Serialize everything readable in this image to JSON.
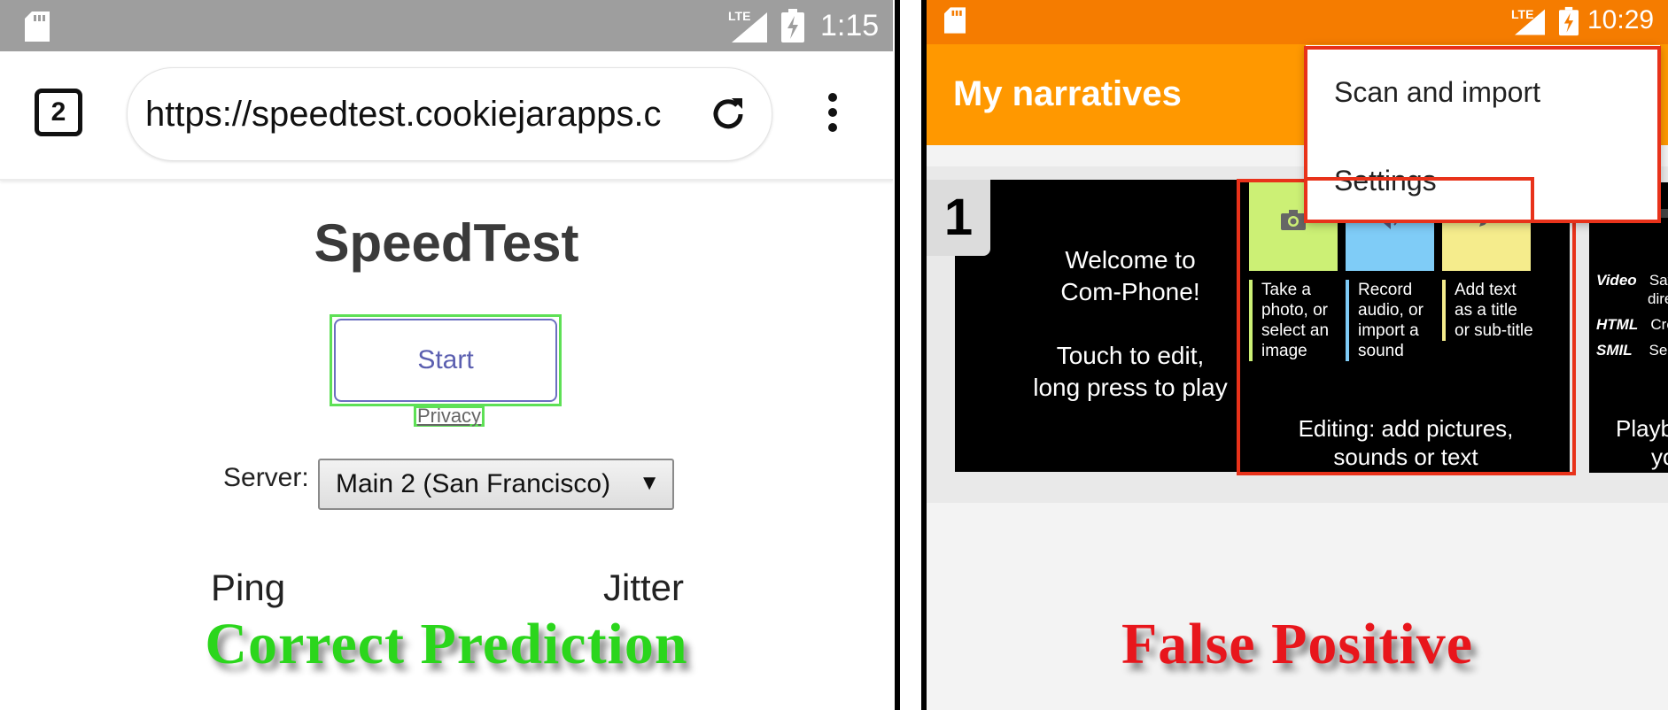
{
  "left_panel": {
    "status_bar": {
      "time": "1:15",
      "network": "LTE",
      "icons": [
        "sd-card-icon",
        "signal-icon",
        "battery-charging-icon"
      ]
    },
    "browser": {
      "tab_count": "2",
      "url": "https://speedtest.cookiejarapps.c",
      "icons": [
        "refresh-icon",
        "more-vert-icon"
      ]
    },
    "page": {
      "title": "SpeedTest",
      "start_button": "Start",
      "privacy_link": "Privacy",
      "server_label": "Server:",
      "server_value": "Main 2 (San Francisco)",
      "server_arrow": "▼",
      "ping_label": "Ping",
      "jitter_label": "Jitter"
    },
    "verdict": "Correct Prediction",
    "highlight_color": "#5ee056"
  },
  "right_panel": {
    "status_bar": {
      "time": "10:29",
      "network": "LTE",
      "icons": [
        "sd-card-icon",
        "signal-icon",
        "battery-charging-icon"
      ]
    },
    "app_bar": {
      "title": "My narratives",
      "color": "#ff9800"
    },
    "menu": {
      "items": [
        "Scan and import",
        "Settings"
      ]
    },
    "cards": {
      "card1": {
        "number": "1",
        "line1": "Welcome to",
        "line2": "Com-Phone!",
        "line3": "Touch to edit,",
        "line4": "long press to play"
      },
      "card2": {
        "tiles": [
          {
            "text": "Take a photo, or select an image",
            "color": "#ccf075",
            "icon": "camera-icon"
          },
          {
            "text": "Record audio, or import a sound",
            "color": "#7fccf7",
            "icon": "speaker-icon"
          },
          {
            "text": "Add text as a title or sub-title",
            "color": "#f5ec8c",
            "icon": "pencil-icon"
          }
        ],
        "caption_line1": "Editing: add pictures,",
        "caption_line2": "sounds or text"
      },
      "card3": {
        "rows": [
          {
            "key": "Video",
            "value": "Save as",
            "value2": "directly"
          },
          {
            "key": "HTML",
            "value": "Create a"
          },
          {
            "key": "SMIL",
            "value": "Send to"
          }
        ],
        "caption_line1": "Playback:",
        "caption_line2": "your"
      }
    },
    "verdict": "False Positive",
    "highlight_color": "#e8321a"
  }
}
